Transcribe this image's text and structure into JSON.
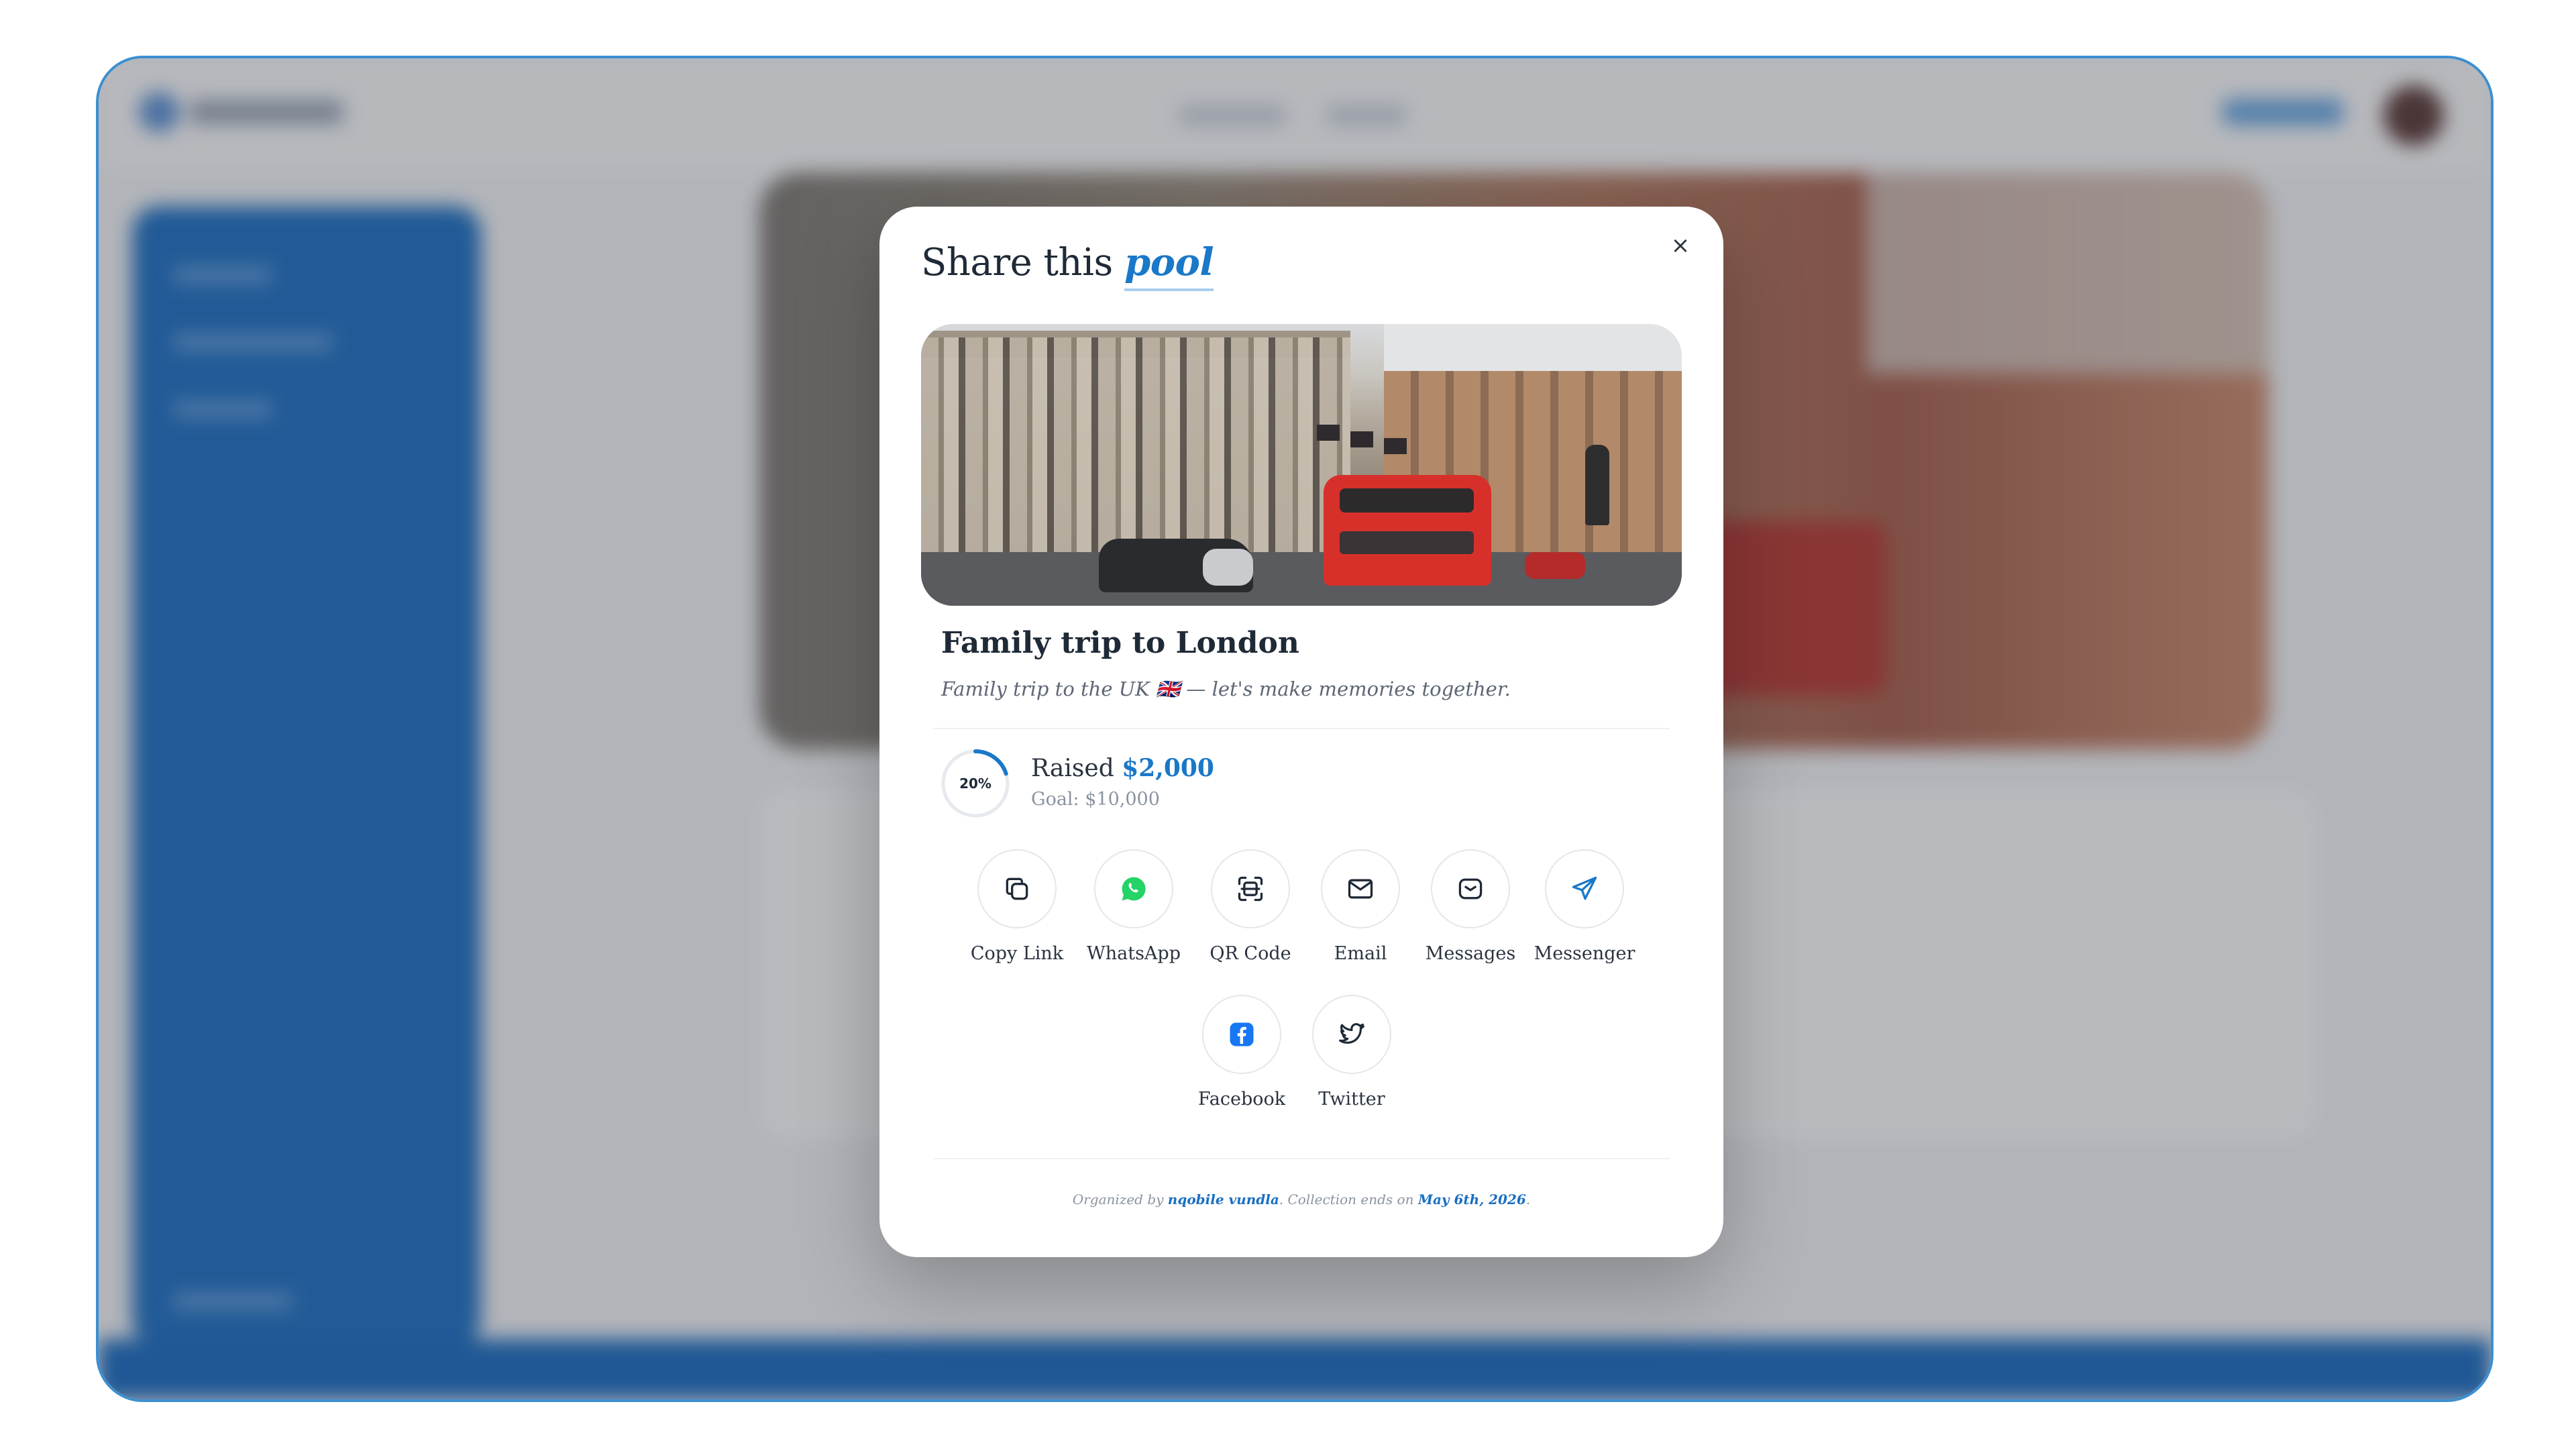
{
  "modal": {
    "title_prefix": "Share this",
    "title_accent": "pool",
    "close_label": "×"
  },
  "pool": {
    "title": "Family trip to London",
    "description": "Family trip to the UK 🇬🇧 — let's make memories together.",
    "progress_percent": 20,
    "progress_label": "20%",
    "raised_label": "Raised",
    "raised_amount": "$2,000",
    "goal_label": "Goal: $10,000"
  },
  "share_options": [
    {
      "label": "Copy Link",
      "icon": "copy-icon"
    },
    {
      "label": "WhatsApp",
      "icon": "whatsapp-icon"
    },
    {
      "label": "QR Code",
      "icon": "qr-code-icon"
    },
    {
      "label": "Email",
      "icon": "email-icon"
    },
    {
      "label": "Messages",
      "icon": "messages-icon"
    },
    {
      "label": "Messenger",
      "icon": "messenger-icon"
    },
    {
      "label": "Facebook",
      "icon": "facebook-icon"
    },
    {
      "label": "Twitter",
      "icon": "twitter-icon"
    }
  ],
  "footer": {
    "organized_by": "Organized by ",
    "organizer": "nqobile vundla",
    "middle": ". Collection ends on ",
    "end_date": "May 6th, 2026",
    "end": "."
  },
  "colors": {
    "accent": "#1a78c8",
    "whatsapp": "#25d366",
    "facebook": "#1877f2",
    "backdrop_primary": "#1f6fc0"
  }
}
